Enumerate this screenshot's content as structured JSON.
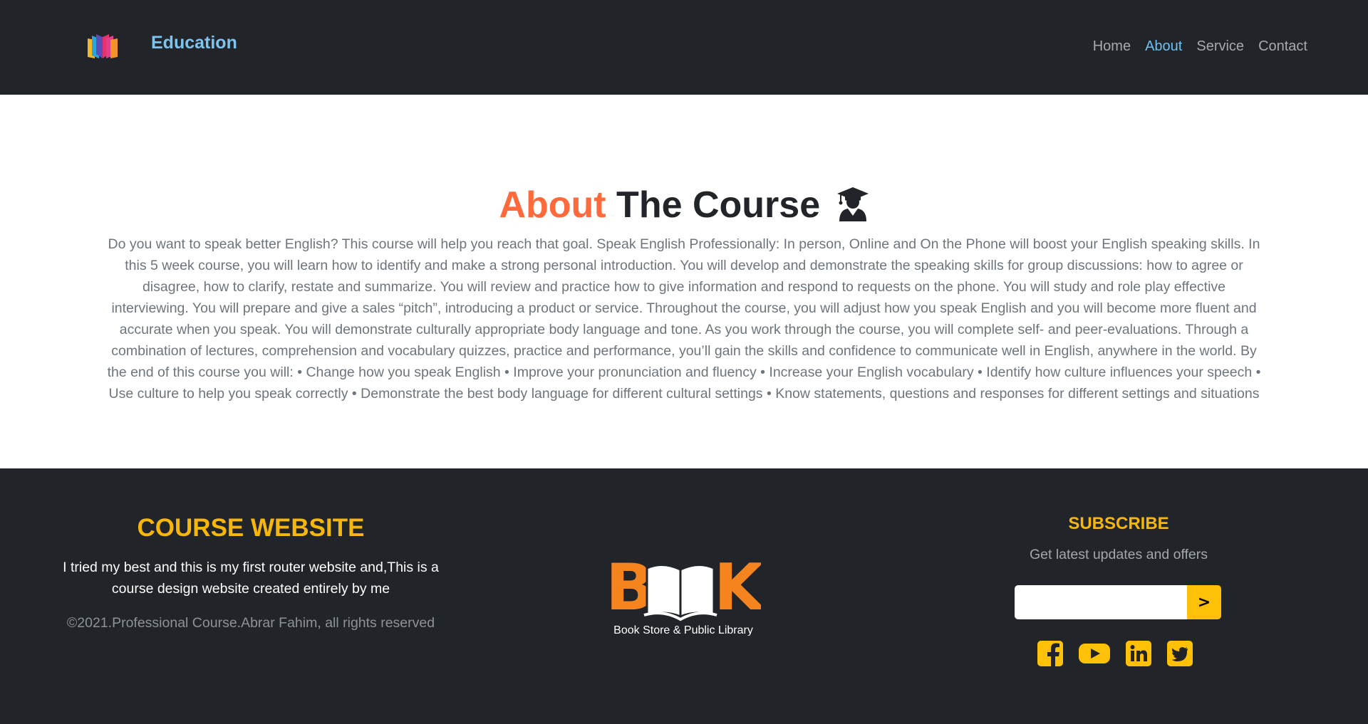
{
  "navbar": {
    "brand": "Education",
    "links": [
      {
        "label": "Home"
      },
      {
        "label": "About"
      },
      {
        "label": "Service"
      },
      {
        "label": "Contact"
      }
    ],
    "active_link": "About",
    "logo_icon": "colorful-book-icon"
  },
  "about": {
    "title_accent": "About",
    "title_rest": " The Course",
    "title_icon": "graduate-user-icon",
    "text": "Do you want to speak better English? This course will help you reach that goal. Speak English Professionally: In person, Online and On the Phone will boost your English speaking skills. In this 5 week course, you will learn how to identify and make a strong personal introduction. You will develop and demonstrate the speaking skills for group discussions: how to agree or disagree, how to clarify, restate and summarize. You will review and practice how to give information and respond to requests on the phone. You will study and role play effective interviewing. You will prepare and give a sales “pitch”, introducing a product or service. Throughout the course, you will adjust how you speak English and you will become more fluent and accurate when you speak. You will demonstrate culturally appropriate body language and tone. As you work through the course, you will complete self- and peer-evaluations. Through a combination of lectures, comprehension and vocabulary quizzes, practice and performance, you’ll gain the skills and confidence to communicate well in English, anywhere in the world. By the end of this course you will: • Change how you speak English • Improve your pronunciation and fluency • Increase your English vocabulary • Identify how culture influences your speech • Use culture to help you speak correctly • Demonstrate the best body language for different cultural settings • Know statements, questions and responses for different settings and situations"
  },
  "footer": {
    "title": "COURSE WEBSITE",
    "description": "I tried my best and this is my first router website and,This is a course design website created entirely by me",
    "copyright": "©2021.Professional Course.Abrar Fahim, all rights reserved",
    "logo": {
      "word_b": "B",
      "word_k": "K",
      "tagline": "Book Store & Public Library"
    },
    "subscribe": {
      "title": "SUBSCRIBE",
      "text": "Get latest updates and offers",
      "input_value": "",
      "button_label": ">"
    },
    "socials": [
      "facebook-icon",
      "youtube-icon",
      "linkedin-icon",
      "twitter-icon"
    ]
  },
  "colors": {
    "dark_bg": "#212529",
    "accent_orange": "#ff6a3d",
    "brand_blue": "#7fc4ee",
    "yellow": "#ffc107"
  }
}
